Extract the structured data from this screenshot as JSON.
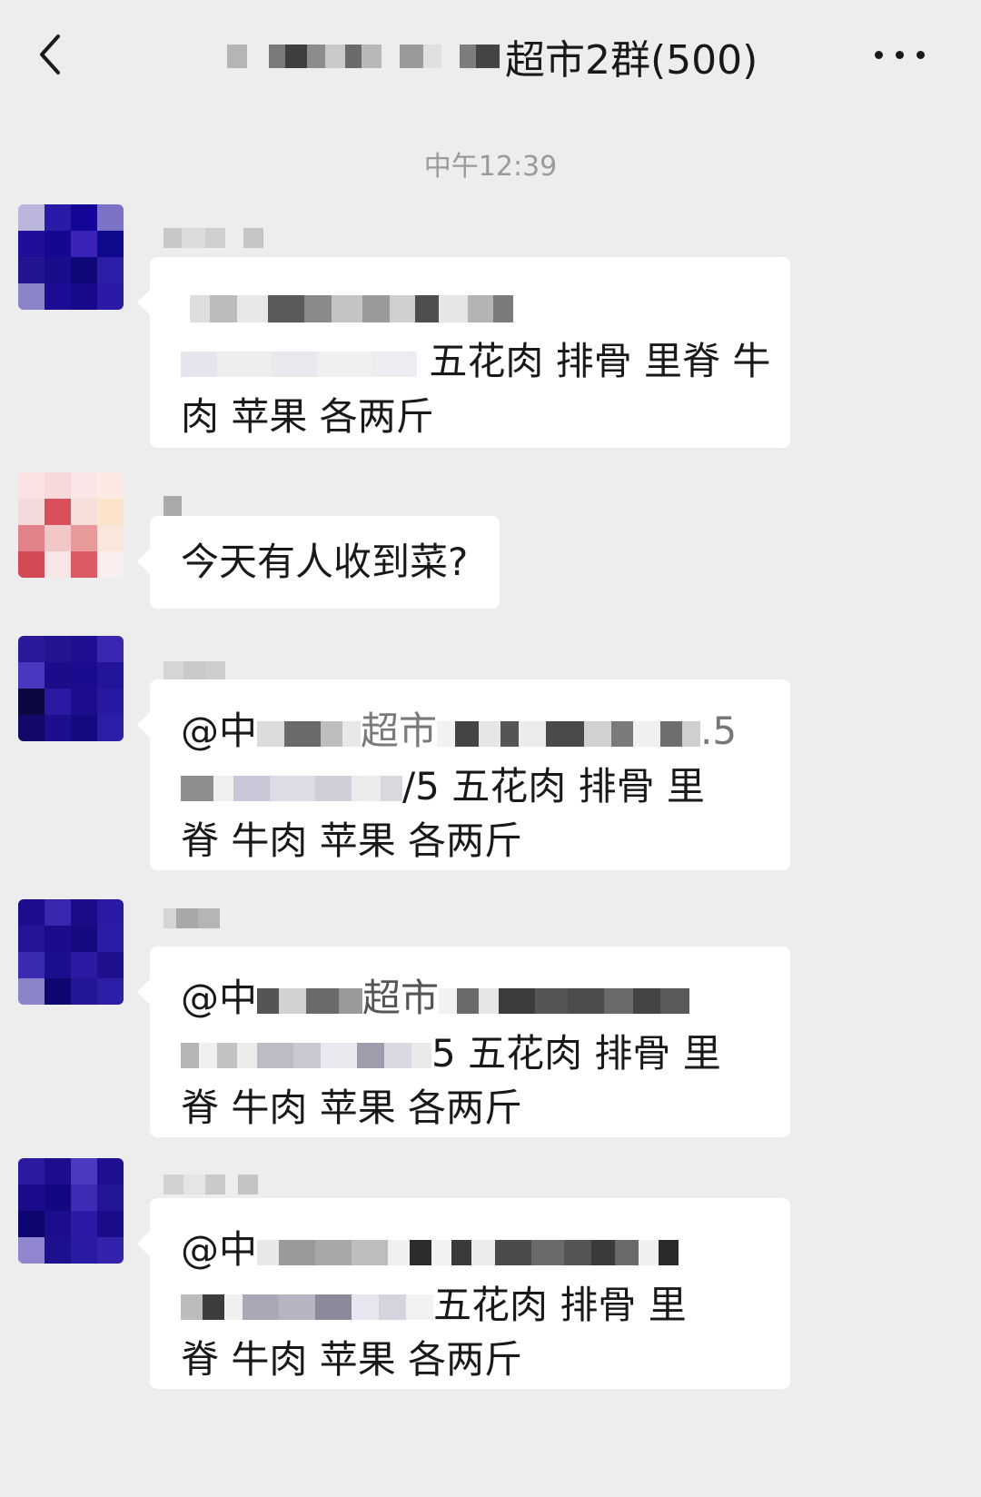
{
  "header": {
    "title": "超市2群(500)",
    "back_icon": "chevron-left-icon",
    "more_icon": "more-dots-icon"
  },
  "timestamp": "中午12:39",
  "messages": [
    {
      "line2_suffix": "五花肉 排骨 里脊 牛",
      "line3": "肉 苹果 各两斤"
    },
    {
      "text": "今天有人收到菜?"
    },
    {
      "line1_prefix": "@中",
      "line1_mid": "超市",
      "line1_suffix": ".5",
      "line2_suffix": "/5 五花肉 排骨 里",
      "line3": "脊 牛肉 苹果 各两斤"
    },
    {
      "line1_prefix": "@中",
      "line1_mid": "超市",
      "line2_suffix": "5 五花肉 排骨 里",
      "line3": "脊 牛肉 苹果 各两斤"
    },
    {
      "line1_prefix": "@中",
      "line2_suffix": "五花肉 排骨 里",
      "line3": "脊 牛肉 苹果 各两斤"
    }
  ],
  "colors": {
    "background": "#ededed",
    "bubble": "#ffffff",
    "avatar_blue": "#1a0a9a",
    "avatar_pink": "#d9505a",
    "timestamp": "#9a9a9a"
  }
}
